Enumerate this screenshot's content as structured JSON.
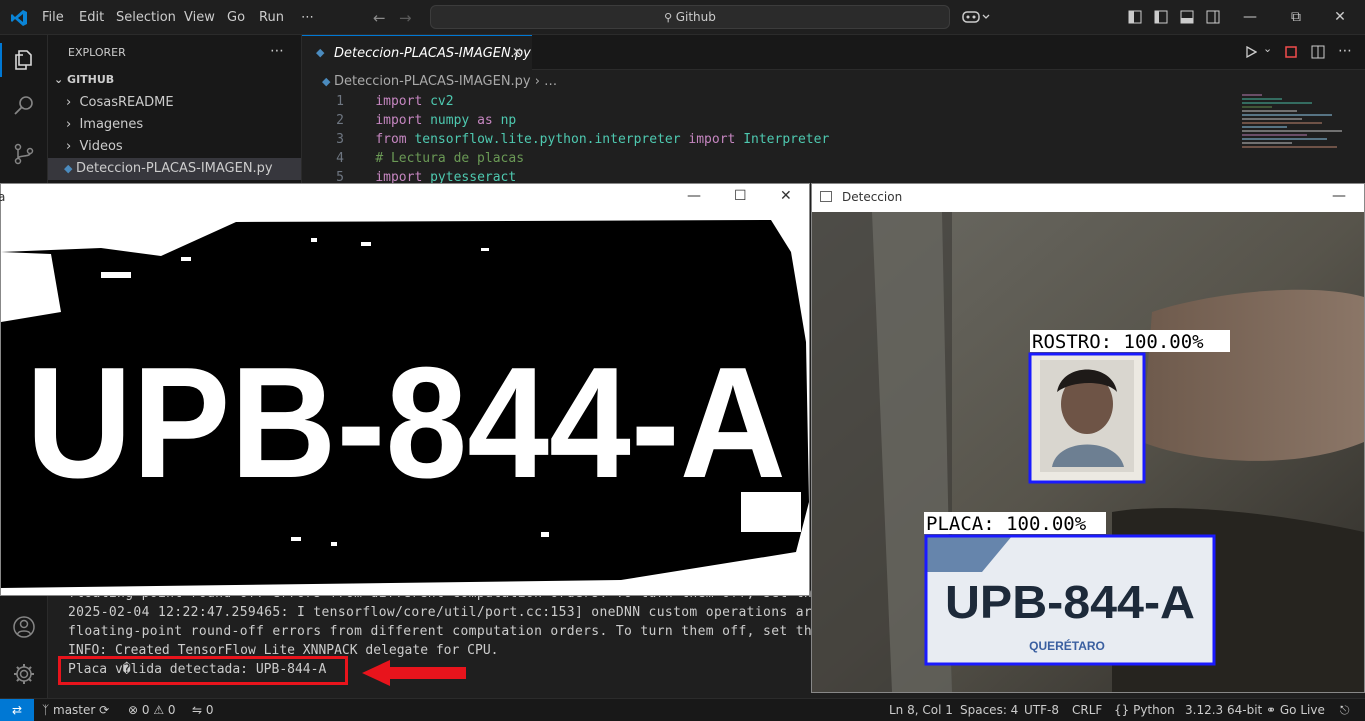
{
  "titlebar": {
    "menu": [
      "File",
      "Edit",
      "Selection",
      "View",
      "Go",
      "Run",
      "⋯"
    ],
    "search_text": "Github"
  },
  "sidebar": {
    "header": "EXPLORER",
    "more": "⋯",
    "folder": "GITHUB",
    "items": [
      "CosasREADME",
      "Imagenes",
      "Videos",
      "Deteccion-PLACAS-IMAGEN.py"
    ]
  },
  "editor": {
    "tab_label": "Deteccion-PLACAS-IMAGEN.py",
    "breadcrumb_file": "Deteccion-PLACAS-IMAGEN.py",
    "breadcrumb_more": "…",
    "lines": [
      {
        "n": "1",
        "parts": [
          [
            "kw",
            "import "
          ],
          [
            "mod",
            "cv2"
          ]
        ]
      },
      {
        "n": "2",
        "parts": [
          [
            "kw",
            "import "
          ],
          [
            "mod",
            "numpy"
          ],
          [
            "kw",
            " as "
          ],
          [
            "mod",
            "np"
          ]
        ]
      },
      {
        "n": "3",
        "parts": [
          [
            "kw",
            "from "
          ],
          [
            "mod",
            "tensorflow.lite.python.interpreter"
          ],
          [
            "kw",
            " import "
          ],
          [
            "mod",
            "Interpreter"
          ]
        ]
      },
      {
        "n": "4",
        "parts": [
          [
            "cm",
            "# Lectura de placas"
          ]
        ]
      },
      {
        "n": "5",
        "parts": [
          [
            "kw",
            "import "
          ],
          [
            "mod",
            "pytesseract"
          ]
        ]
      }
    ]
  },
  "terminal": {
    "lines": [
      "floating-point round-off errors from different computation orders. To turn them off, set the",
      "2025-02-04 12:22:47.259465: I tensorflow/core/util/port.cc:153] oneDNN custom operations are",
      "floating-point round-off errors from different computation orders. To turn them off, set the",
      "INFO: Created TensorFlow Lite XNNPACK delegate for CPU."
    ],
    "highlight": "Placa v�lida detectada: UPB-844-A"
  },
  "win_placa": {
    "title": "a",
    "plate_text": "UPB-844-A"
  },
  "win_det": {
    "title": "Deteccion",
    "face_label": "ROSTRO: 100.00%",
    "plate_label": "PLACA: 100.00%",
    "plate_text": "UPB-844-A",
    "plate_sub": "QUERÉTARO"
  },
  "status": {
    "branch": "master",
    "problems": "⊗ 0 ⚠ 0",
    "ports": "0",
    "position": "Ln 8, Col 1",
    "spaces": "Spaces: 4",
    "encoding": "UTF-8",
    "eol": "CRLF",
    "language": "Python",
    "interpreter": "3.12.3 64-bit",
    "golive": "Go Live"
  },
  "colors": {
    "accent": "#0078d4",
    "annotation_red": "#e8141c",
    "box_blue": "#1a1aff"
  }
}
